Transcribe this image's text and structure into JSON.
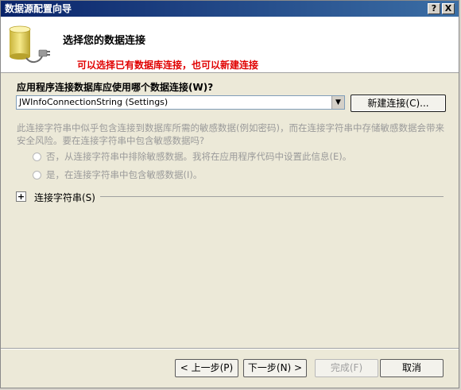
{
  "window": {
    "title": "数据源配置向导",
    "help_label": "?",
    "close_label": "X"
  },
  "header": {
    "title": "选择您的数据连接",
    "annotation": "可以选择已有数据库连接，也可以新建连接"
  },
  "connection": {
    "question": "应用程序连接数据库应使用哪个数据连接(W)?",
    "selected": "JWInfoConnectionString (Settings)",
    "new_button": "新建连接(C)..."
  },
  "sensitive": {
    "info": "此连接字符串中似乎包含连接到数据库所需的敏感数据(例如密码)，而在连接字符串中存储敏感数据会带来安全风险。要在连接字符串中包含敏感数据吗?",
    "option_no": "否，从连接字符串中排除敏感数据。我将在应用程序代码中设置此信息(E)。",
    "option_yes": "是，在连接字符串中包含敏感数据(I)。"
  },
  "connection_string": {
    "toggle": "+",
    "label": "连接字符串(S)"
  },
  "footer": {
    "prev": "< 上一步(P)",
    "next": "下一步(N) >",
    "finish": "完成(F)",
    "cancel": "取消"
  },
  "colors": {
    "annotation": "#e00000",
    "titlebar": "#0a246a",
    "disabled_text": "#9a9a9a"
  }
}
